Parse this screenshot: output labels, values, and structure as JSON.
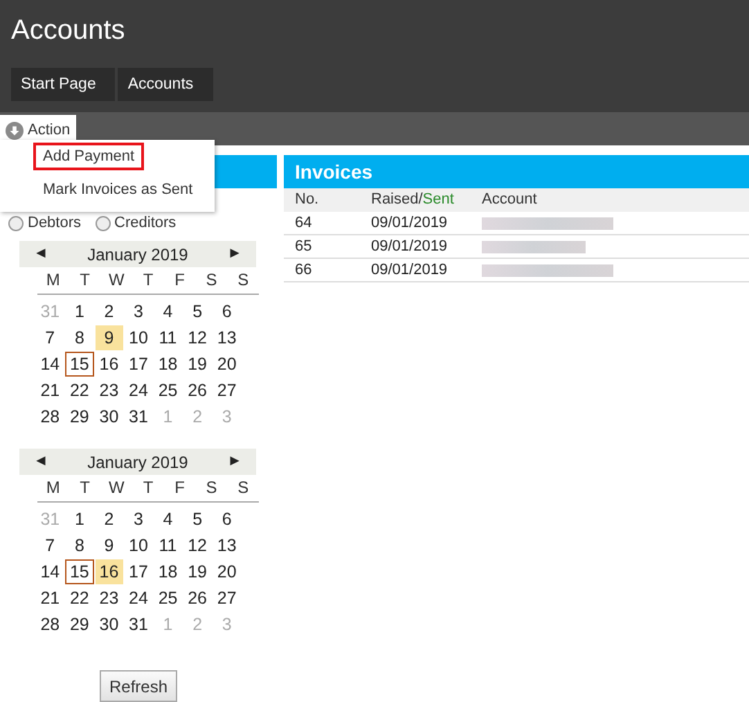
{
  "header": {
    "title": "Accounts"
  },
  "breadcrumbs": [
    {
      "label": "Start Page"
    },
    {
      "label": "Accounts"
    }
  ],
  "action_menu": {
    "label": "Action",
    "expanded": true,
    "items": [
      {
        "label": "Add Payment",
        "selected": true
      },
      {
        "label": "Mark Invoices as Sent",
        "selected": false
      }
    ]
  },
  "account_type": [
    {
      "label": "Debtors",
      "selected": false
    },
    {
      "label": "Creditors",
      "selected": false
    }
  ],
  "calendars": [
    {
      "month": "January 2019",
      "prev": "◄",
      "next": "►",
      "weekdays": [
        "M",
        "T",
        "W",
        "T",
        "F",
        "S",
        "S"
      ],
      "weeks": [
        [
          {
            "day": "31",
            "other_month": true,
            "selected": false,
            "today": false
          },
          {
            "day": "1",
            "other_month": false,
            "selected": false,
            "today": false
          },
          {
            "day": "2",
            "other_month": false,
            "selected": false,
            "today": false
          },
          {
            "day": "3",
            "other_month": false,
            "selected": false,
            "today": false
          },
          {
            "day": "4",
            "other_month": false,
            "selected": false,
            "today": false
          },
          {
            "day": "5",
            "other_month": false,
            "selected": false,
            "today": false
          },
          {
            "day": "6",
            "other_month": false,
            "selected": false,
            "today": false
          }
        ],
        [
          {
            "day": "7",
            "other_month": false,
            "selected": false,
            "today": false
          },
          {
            "day": "8",
            "other_month": false,
            "selected": false,
            "today": false
          },
          {
            "day": "9",
            "other_month": false,
            "selected": true,
            "today": false
          },
          {
            "day": "10",
            "other_month": false,
            "selected": false,
            "today": false
          },
          {
            "day": "11",
            "other_month": false,
            "selected": false,
            "today": false
          },
          {
            "day": "12",
            "other_month": false,
            "selected": false,
            "today": false
          },
          {
            "day": "13",
            "other_month": false,
            "selected": false,
            "today": false
          }
        ],
        [
          {
            "day": "14",
            "other_month": false,
            "selected": false,
            "today": false
          },
          {
            "day": "15",
            "other_month": false,
            "selected": false,
            "today": true
          },
          {
            "day": "16",
            "other_month": false,
            "selected": false,
            "today": false
          },
          {
            "day": "17",
            "other_month": false,
            "selected": false,
            "today": false
          },
          {
            "day": "18",
            "other_month": false,
            "selected": false,
            "today": false
          },
          {
            "day": "19",
            "other_month": false,
            "selected": false,
            "today": false
          },
          {
            "day": "20",
            "other_month": false,
            "selected": false,
            "today": false
          }
        ],
        [
          {
            "day": "21",
            "other_month": false,
            "selected": false,
            "today": false
          },
          {
            "day": "22",
            "other_month": false,
            "selected": false,
            "today": false
          },
          {
            "day": "23",
            "other_month": false,
            "selected": false,
            "today": false
          },
          {
            "day": "24",
            "other_month": false,
            "selected": false,
            "today": false
          },
          {
            "day": "25",
            "other_month": false,
            "selected": false,
            "today": false
          },
          {
            "day": "26",
            "other_month": false,
            "selected": false,
            "today": false
          },
          {
            "day": "27",
            "other_month": false,
            "selected": false,
            "today": false
          }
        ],
        [
          {
            "day": "28",
            "other_month": false,
            "selected": false,
            "today": false
          },
          {
            "day": "29",
            "other_month": false,
            "selected": false,
            "today": false
          },
          {
            "day": "30",
            "other_month": false,
            "selected": false,
            "today": false
          },
          {
            "day": "31",
            "other_month": false,
            "selected": false,
            "today": false
          },
          {
            "day": "1",
            "other_month": true,
            "selected": false,
            "today": false
          },
          {
            "day": "2",
            "other_month": true,
            "selected": false,
            "today": false
          },
          {
            "day": "3",
            "other_month": true,
            "selected": false,
            "today": false
          }
        ]
      ]
    },
    {
      "month": "January 2019",
      "prev": "◄",
      "next": "►",
      "weekdays": [
        "M",
        "T",
        "W",
        "T",
        "F",
        "S",
        "S"
      ],
      "weeks": [
        [
          {
            "day": "31",
            "other_month": true,
            "selected": false,
            "today": false
          },
          {
            "day": "1",
            "other_month": false,
            "selected": false,
            "today": false
          },
          {
            "day": "2",
            "other_month": false,
            "selected": false,
            "today": false
          },
          {
            "day": "3",
            "other_month": false,
            "selected": false,
            "today": false
          },
          {
            "day": "4",
            "other_month": false,
            "selected": false,
            "today": false
          },
          {
            "day": "5",
            "other_month": false,
            "selected": false,
            "today": false
          },
          {
            "day": "6",
            "other_month": false,
            "selected": false,
            "today": false
          }
        ],
        [
          {
            "day": "7",
            "other_month": false,
            "selected": false,
            "today": false
          },
          {
            "day": "8",
            "other_month": false,
            "selected": false,
            "today": false
          },
          {
            "day": "9",
            "other_month": false,
            "selected": false,
            "today": false
          },
          {
            "day": "10",
            "other_month": false,
            "selected": false,
            "today": false
          },
          {
            "day": "11",
            "other_month": false,
            "selected": false,
            "today": false
          },
          {
            "day": "12",
            "other_month": false,
            "selected": false,
            "today": false
          },
          {
            "day": "13",
            "other_month": false,
            "selected": false,
            "today": false
          }
        ],
        [
          {
            "day": "14",
            "other_month": false,
            "selected": false,
            "today": false
          },
          {
            "day": "15",
            "other_month": false,
            "selected": false,
            "today": true
          },
          {
            "day": "16",
            "other_month": false,
            "selected": true,
            "today": false
          },
          {
            "day": "17",
            "other_month": false,
            "selected": false,
            "today": false
          },
          {
            "day": "18",
            "other_month": false,
            "selected": false,
            "today": false
          },
          {
            "day": "19",
            "other_month": false,
            "selected": false,
            "today": false
          },
          {
            "day": "20",
            "other_month": false,
            "selected": false,
            "today": false
          }
        ],
        [
          {
            "day": "21",
            "other_month": false,
            "selected": false,
            "today": false
          },
          {
            "day": "22",
            "other_month": false,
            "selected": false,
            "today": false
          },
          {
            "day": "23",
            "other_month": false,
            "selected": false,
            "today": false
          },
          {
            "day": "24",
            "other_month": false,
            "selected": false,
            "today": false
          },
          {
            "day": "25",
            "other_month": false,
            "selected": false,
            "today": false
          },
          {
            "day": "26",
            "other_month": false,
            "selected": false,
            "today": false
          },
          {
            "day": "27",
            "other_month": false,
            "selected": false,
            "today": false
          }
        ],
        [
          {
            "day": "28",
            "other_month": false,
            "selected": false,
            "today": false
          },
          {
            "day": "29",
            "other_month": false,
            "selected": false,
            "today": false
          },
          {
            "day": "30",
            "other_month": false,
            "selected": false,
            "today": false
          },
          {
            "day": "31",
            "other_month": false,
            "selected": false,
            "today": false
          },
          {
            "day": "1",
            "other_month": true,
            "selected": false,
            "today": false
          },
          {
            "day": "2",
            "other_month": true,
            "selected": false,
            "today": false
          },
          {
            "day": "3",
            "other_month": true,
            "selected": false,
            "today": false
          }
        ]
      ]
    }
  ],
  "refresh_button": "Refresh",
  "invoices": {
    "title": "Invoices",
    "columns": [
      {
        "parts": [
          "No."
        ]
      },
      {
        "parts": [
          "Raised/",
          "Sent"
        ]
      },
      {
        "parts": [
          "Account"
        ]
      }
    ],
    "rows": [
      {
        "no": "64",
        "date": "09/01/2019"
      },
      {
        "no": "65",
        "date": "09/01/2019"
      },
      {
        "no": "66",
        "date": "09/01/2019"
      }
    ]
  }
}
